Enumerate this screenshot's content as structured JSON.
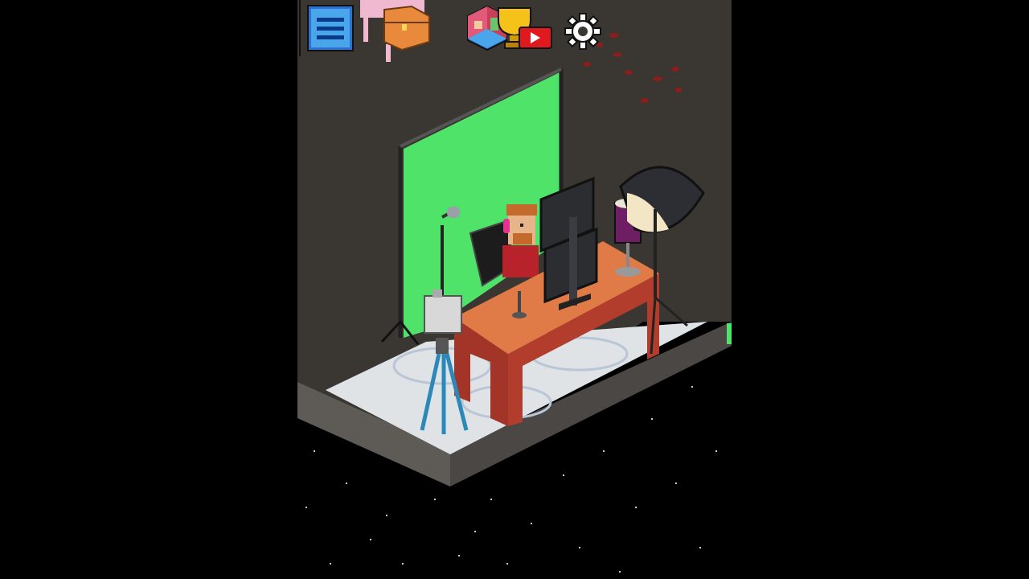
{
  "window": {
    "background": "#000000"
  },
  "hud": {
    "buttons": [
      {
        "id": "menu",
        "icon": "hamburger-menu-icon"
      },
      {
        "id": "inventory",
        "icon": "treasure-chest-icon"
      },
      {
        "id": "decorate",
        "icon": "room-decor-icon"
      },
      {
        "id": "achievements",
        "icon": "trophy-video-icon"
      },
      {
        "id": "settings",
        "icon": "gear-icon"
      }
    ]
  },
  "scene": {
    "wall_color": "#3a3733",
    "floor_color": "#d6dcdf",
    "greenscreen_color": "#4fe36a",
    "desk_color": "#e07a46",
    "space_color": "#000000"
  }
}
